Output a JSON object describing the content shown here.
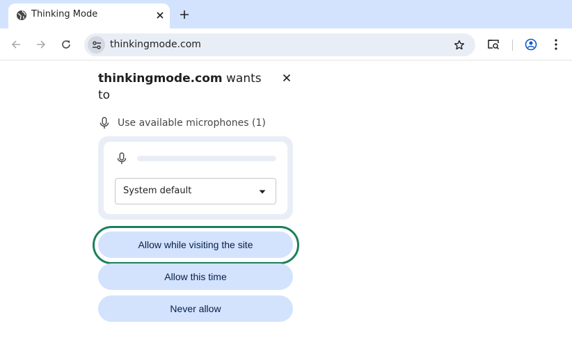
{
  "tab": {
    "title": "Thinking Mode",
    "favicon": "globe-icon"
  },
  "toolbar": {
    "url": "thinkingmode.com",
    "icons": [
      "back-arrow-icon",
      "forward-arrow-icon",
      "reload-icon",
      "site-info-icon",
      "bookmark-star-icon",
      "lens-search-icon",
      "profile-icon",
      "kebab-menu-icon"
    ]
  },
  "permission_prompt": {
    "site": "thinkingmode.com",
    "wants_text": "wants to",
    "permission_label": "Use available microphones (1)",
    "mic_level": 0,
    "device": {
      "selected": "System default"
    },
    "buttons": {
      "allow_while_visiting": "Allow while visiting the site",
      "allow_this_time": "Allow this time",
      "never_allow": "Never allow"
    }
  },
  "colors": {
    "tabstrip": "#d3e3fd",
    "omnibox": "#e9eef6",
    "button_fill": "#d3e3fd",
    "focus_ring": "#1b7f5e"
  }
}
